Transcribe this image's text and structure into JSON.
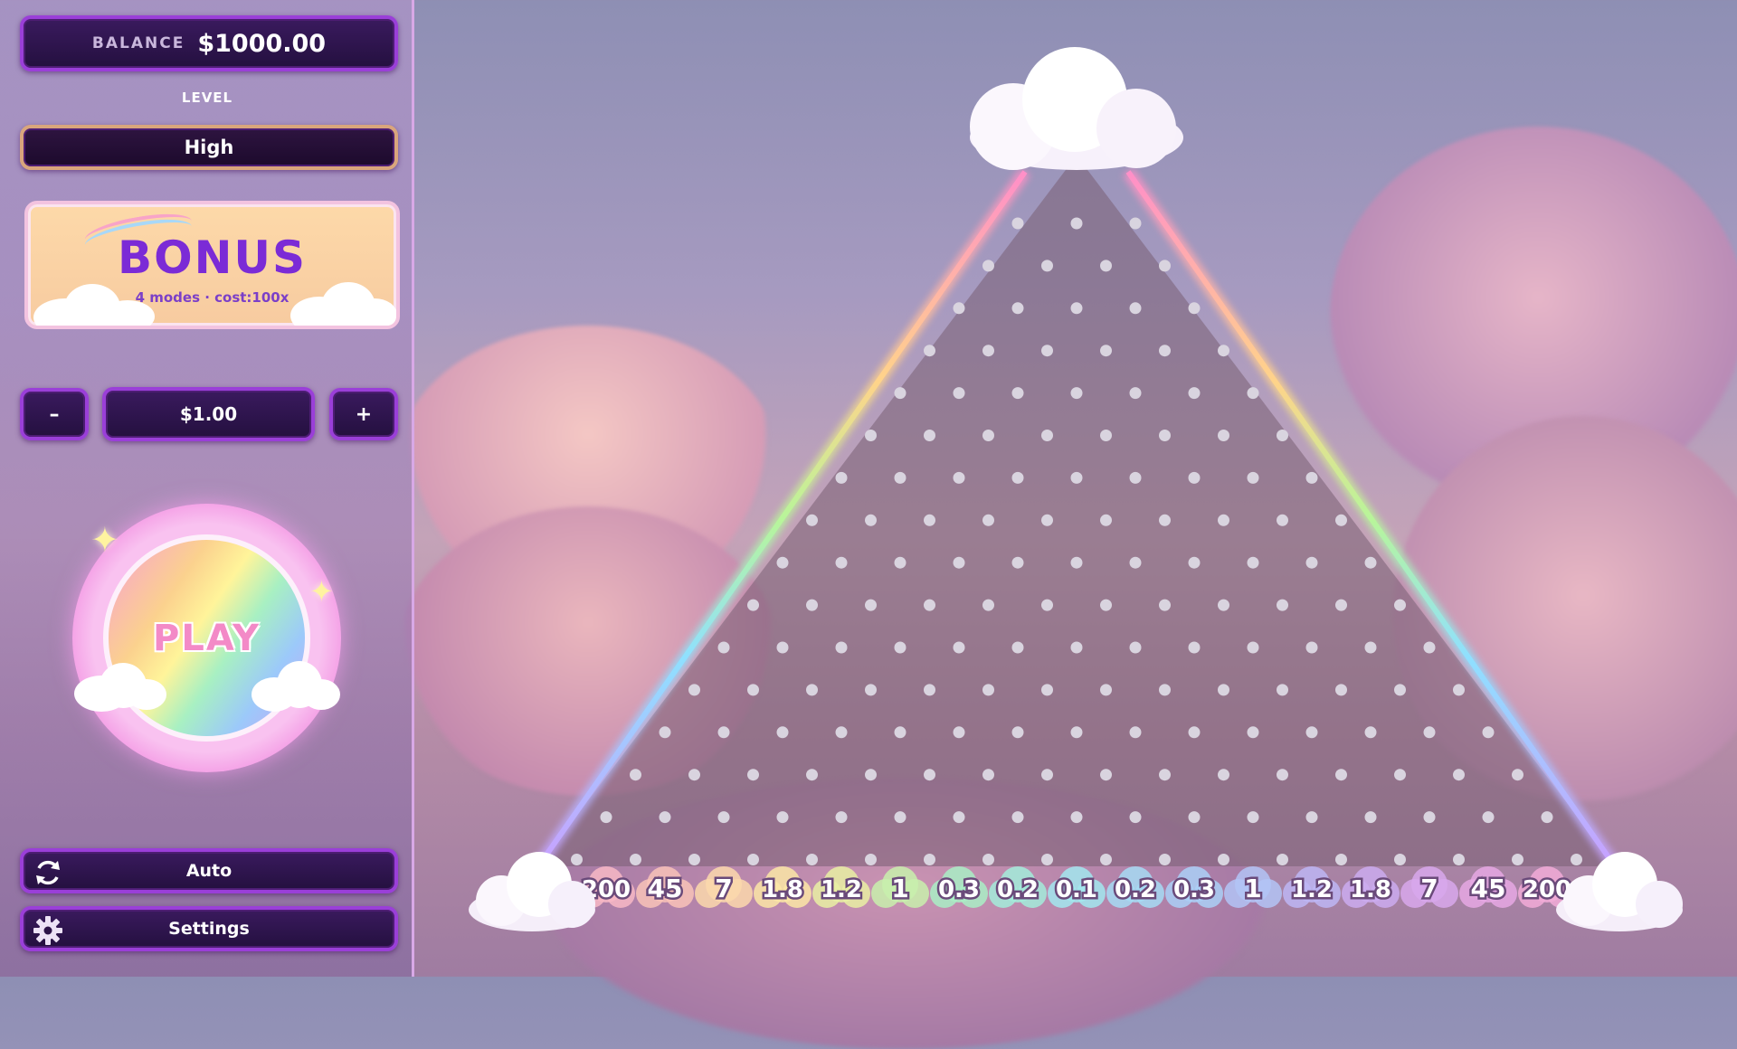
{
  "balance": {
    "label": "BALANCE",
    "value": "$1000.00"
  },
  "level": {
    "label": "LEVEL",
    "value": "High"
  },
  "bonus": {
    "title": "BONUS",
    "subtitle": "4 modes · cost:100x"
  },
  "bet": {
    "minus_label": "–",
    "amount": "$1.00",
    "plus_label": "+"
  },
  "play": {
    "label": "PLAY"
  },
  "auto": {
    "label": "Auto",
    "icon": "refresh-icon"
  },
  "settings": {
    "label": "Settings",
    "icon": "gear-icon"
  },
  "board": {
    "rows": 16,
    "multipliers": [
      "200",
      "45",
      "7",
      "1.8",
      "1.2",
      "1",
      "0.3",
      "0.2",
      "0.1",
      "0.2",
      "0.3",
      "1",
      "1.2",
      "1.8",
      "7",
      "45",
      "200"
    ],
    "slot_colors": [
      "#f8b9c5",
      "#f9c3b8",
      "#fbd8ab",
      "#fbe6a6",
      "#e9f0a3",
      "#c8f0ad",
      "#a9eec5",
      "#a3ecdb",
      "#a2e7ee",
      "#a6dcf5",
      "#aad0f7",
      "#b3c4f6",
      "#bdb6f4",
      "#cbacf0",
      "#d8a8ec",
      "#e6a8e4",
      "#f2acd8"
    ],
    "accent_colors": {
      "peg": "#d9d4df",
      "frame": "#24103f",
      "border": "#9a3fd8"
    }
  }
}
